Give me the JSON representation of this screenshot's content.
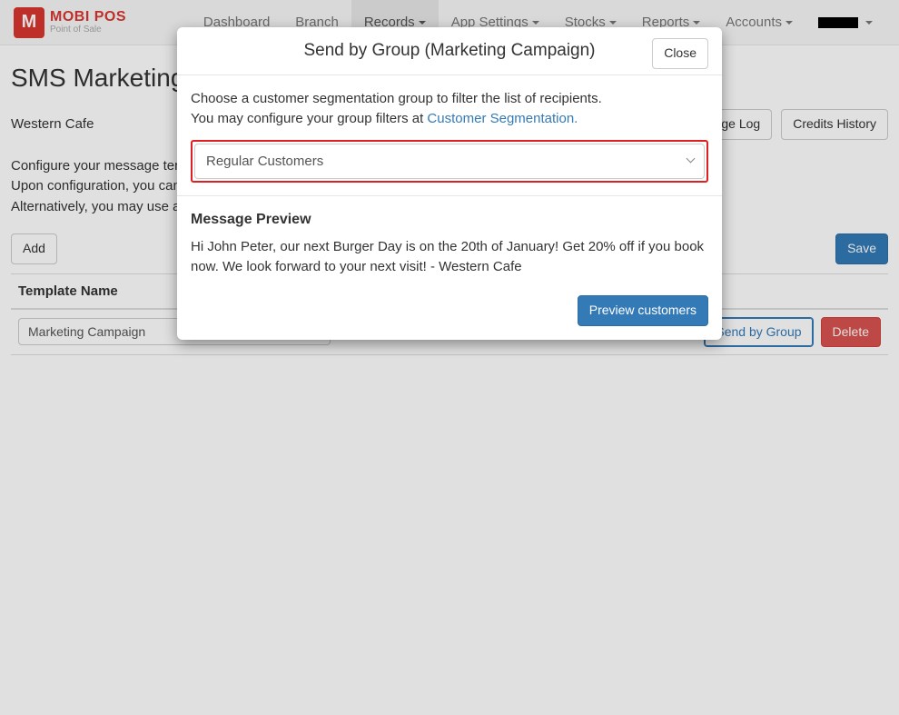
{
  "brand": {
    "name": "MOBI POS",
    "subtitle": "Point of Sale"
  },
  "nav": {
    "items": [
      {
        "label": "Dashboard",
        "dropdown": false
      },
      {
        "label": "Branch",
        "dropdown": false
      },
      {
        "label": "Records",
        "dropdown": true,
        "active": true
      },
      {
        "label": "App Settings",
        "dropdown": true
      },
      {
        "label": "Stocks",
        "dropdown": true
      },
      {
        "label": "Reports",
        "dropdown": true
      },
      {
        "label": "Accounts",
        "dropdown": true
      }
    ]
  },
  "page": {
    "title": "SMS Marketing",
    "branch": "Western Cafe",
    "side_tabs": {
      "log": "Message Log",
      "credits": "Credits History"
    },
    "desc_line1": "Configure your message templates below to be used when sending in a marketing campaign.",
    "desc_line2": "Upon configuration, you can send marketing mass SMS to various customers using Send by Group function.",
    "desc_line3": "Alternatively, you may use an API to integrate with your own systems.",
    "add_btn": "Add",
    "save_btn": "Save",
    "table": {
      "header_name": "Template Name",
      "rows": [
        {
          "name": "Marketing Campaign",
          "send_by_group": "Send by Group",
          "delete": "Delete"
        }
      ]
    }
  },
  "modal": {
    "title": "Send by Group (Marketing Campaign)",
    "close": "Close",
    "instruction1": "Choose a customer segmentation group to filter the list of recipients.",
    "instruction2_prefix": "You may configure your group filters at ",
    "instruction2_link": "Customer Segmentation.",
    "selected_group": "Regular Customers",
    "preview_title": "Message Preview",
    "preview_body": "Hi John Peter, our next Burger Day is on the 20th of January! Get 20% off if you book now. We look forward to your next visit! - Western Cafe",
    "preview_btn": "Preview customers"
  }
}
